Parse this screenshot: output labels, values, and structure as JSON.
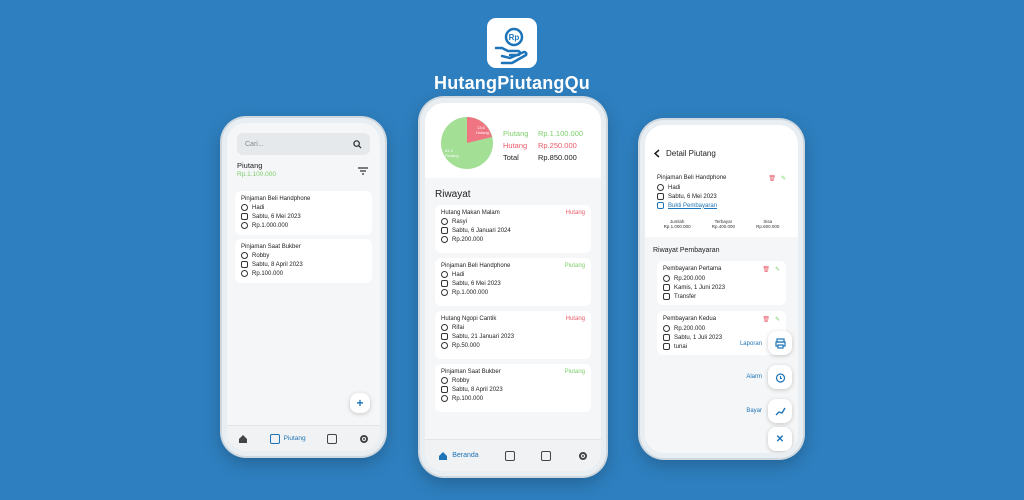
{
  "brand": {
    "app_name": "HutangPiutangQu",
    "logo_text": "Rp"
  },
  "phone_left": {
    "search_placeholder": "Cari...",
    "section_title": "Piutang",
    "section_total": "Rp.1.100.000",
    "items": [
      {
        "title": "Pinjaman Beli Handphone",
        "person": "Hadi",
        "date": "Sabtu, 6 Mei 2023",
        "amount": "Rp.1.000.000"
      },
      {
        "title": "Pinjaman Saat Bukber",
        "person": "Robby",
        "date": "Sabtu, 8 April 2023",
        "amount": "Rp.100.000"
      }
    ],
    "fab_label": "+",
    "nav": {
      "active_label": "Piutang"
    }
  },
  "phone_center": {
    "pie": {
      "slice_red_value": "13,6",
      "slice_red_label": "Hutang",
      "slice_green_value": "81,3",
      "slice_green_label": "Piutang"
    },
    "summary": [
      {
        "label": "Piutang",
        "value": "Rp.1.100.000",
        "color": "#7ccf6b"
      },
      {
        "label": "Hutang",
        "value": "Rp.250.000",
        "color": "#e85a68"
      },
      {
        "label": "Total",
        "value": "Rp.850.000",
        "color": "#222222"
      }
    ],
    "section_title": "Riwayat",
    "items": [
      {
        "title": "Hutang Makan Malam",
        "tag": "Hutang",
        "tag_color": "#e85a68",
        "person": "Rasyi",
        "date": "Sabtu, 6 Januari 2024",
        "amount": "Rp.200.000"
      },
      {
        "title": "Pinjaman Beli Handphone",
        "tag": "Piutang",
        "tag_color": "#7ccf6b",
        "person": "Hadi",
        "date": "Sabtu, 6 Mei 2023",
        "amount": "Rp.1.000.000"
      },
      {
        "title": "Hutang Ngopi Cantik",
        "tag": "Hutang",
        "tag_color": "#e85a68",
        "person": "Rifai",
        "date": "Sabtu, 21 Januari 2023",
        "amount": "Rp.50.000"
      },
      {
        "title": "Pinjaman Saat Bukber",
        "tag": "Piutang",
        "tag_color": "#7ccf6b",
        "person": "Robby",
        "date": "Sabtu, 8 April 2023",
        "amount": "Rp.100.000"
      }
    ],
    "nav": {
      "active_label": "Beranda"
    }
  },
  "phone_right": {
    "header_title": "Detail Piutang",
    "detail": {
      "title": "Pinjaman Beli Handphone",
      "person": "Hadi",
      "date": "Sabtu, 6 Mei 2023",
      "proof_link": "Bukti Pembayaran",
      "stats": [
        {
          "label": "Jumlah",
          "value": "Rp.1.000.000"
        },
        {
          "label": "Terbayar",
          "value": "Rp.400.000"
        },
        {
          "label": "Sisa",
          "value": "Rp.600.000"
        }
      ]
    },
    "section_title": "Riwayat Pembayaran",
    "payments": [
      {
        "title": "Pembayaran Pertama",
        "amount": "Rp.200.000",
        "date": "Kamis, 1 Juni 2023",
        "method": "Transfer"
      },
      {
        "title": "Pembayaran Kedua",
        "amount": "Rp.200.000",
        "date": "Sabtu, 1 Juli 2023",
        "method": "tunai"
      }
    ],
    "fab_menu": [
      {
        "label": "Laporan",
        "icon": "printer-icon"
      },
      {
        "label": "Alarm",
        "icon": "alarm-icon"
      },
      {
        "label": "Bayar",
        "icon": "pay-icon"
      }
    ],
    "close_label": "✕"
  }
}
